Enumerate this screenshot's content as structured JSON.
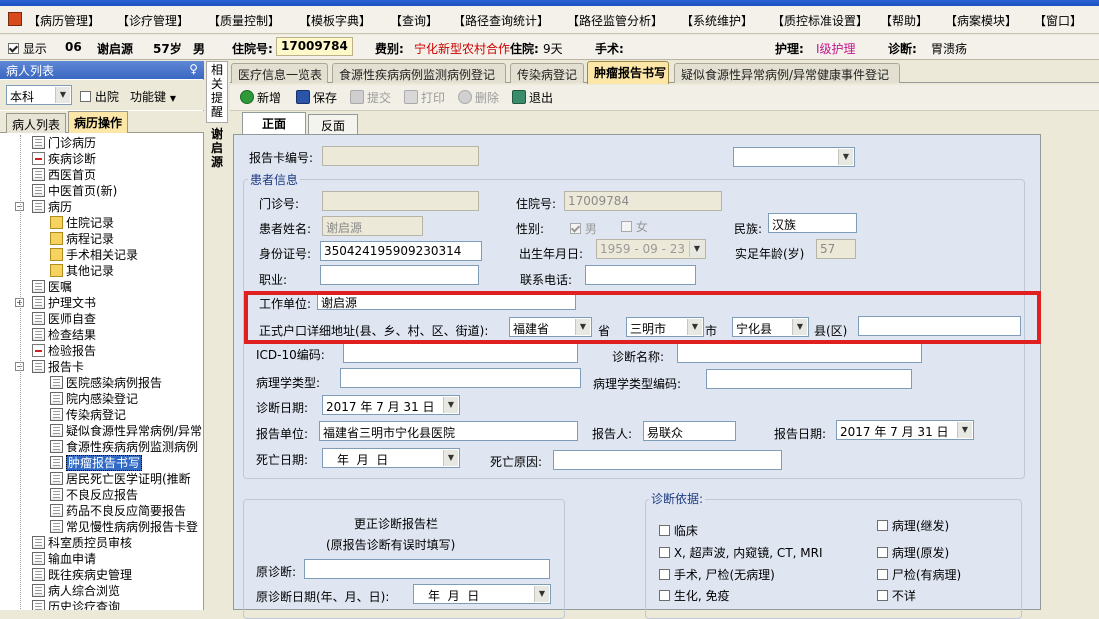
{
  "menu": [
    "【病历管理】",
    "【诊疗管理】",
    "【质量控制】",
    "【模板字典】",
    "【查询】",
    "【路径查询统计】",
    "【路径监管分析】",
    "【系统维护】",
    "【质控标准设置】",
    "【帮助】",
    "【病案模块】",
    "【窗口】"
  ],
  "patient": {
    "show_label": "显示",
    "bed": "06",
    "name": "谢启源",
    "age": "57岁",
    "gender": "男",
    "inpatient_no_label": "住院号:",
    "inpatient_no": "17009784",
    "fee_label": "费别:",
    "fee_type": "宁化新型农村合作",
    "stay_label": "住院:",
    "stay_days": "9天",
    "surgery_label": "手术:",
    "nursing_label": "护理:",
    "nursing_level": "Ⅰ级护理",
    "diagnosis_label": "诊断:",
    "diagnosis": "胃溃疡"
  },
  "left_panel": {
    "title": "病人列表",
    "pin": "♀",
    "dept": "本科",
    "discharged_label": "出院",
    "func_key": "功能键",
    "tabs": [
      "病人列表",
      "病历操作"
    ],
    "tree": [
      {
        "label": "门诊病历",
        "level": 1,
        "icon": "doc"
      },
      {
        "label": "疾病诊断",
        "level": 1,
        "icon": "red"
      },
      {
        "label": "西医首页",
        "level": 1,
        "icon": "doc"
      },
      {
        "label": "中医首页(新)",
        "level": 1,
        "icon": "doc"
      },
      {
        "label": "病历",
        "level": 1,
        "icon": "doc",
        "expand": "−"
      },
      {
        "label": "住院记录",
        "level": 2,
        "icon": "folder"
      },
      {
        "label": "病程记录",
        "level": 2,
        "icon": "folder"
      },
      {
        "label": "手术相关记录",
        "level": 2,
        "icon": "folder"
      },
      {
        "label": "其他记录",
        "level": 2,
        "icon": "folder"
      },
      {
        "label": "医嘱",
        "level": 1,
        "icon": "doc"
      },
      {
        "label": "护理文书",
        "level": 1,
        "icon": "doc",
        "expand": "+"
      },
      {
        "label": "医师自查",
        "level": 1,
        "icon": "doc"
      },
      {
        "label": "检查结果",
        "level": 1,
        "icon": "doc"
      },
      {
        "label": "检验报告",
        "level": 1,
        "icon": "red"
      },
      {
        "label": "报告卡",
        "level": 1,
        "icon": "doc",
        "expand": "−"
      },
      {
        "label": "医院感染病例报告",
        "level": 2,
        "icon": "doc"
      },
      {
        "label": "院内感染登记",
        "level": 2,
        "icon": "doc"
      },
      {
        "label": "传染病登记",
        "level": 2,
        "icon": "doc"
      },
      {
        "label": "疑似食源性异常病例/异常",
        "level": 2,
        "icon": "doc"
      },
      {
        "label": "食源性疾病病例监测病例",
        "level": 2,
        "icon": "doc"
      },
      {
        "label": "肿瘤报告书写",
        "level": 2,
        "icon": "doc",
        "selected": true
      },
      {
        "label": "居民死亡医学证明(推断",
        "level": 2,
        "icon": "doc"
      },
      {
        "label": "不良反应报告",
        "level": 2,
        "icon": "doc"
      },
      {
        "label": "药品不良反应简要报告",
        "level": 2,
        "icon": "doc"
      },
      {
        "label": "常见慢性病病例报告卡登",
        "level": 2,
        "icon": "doc"
      },
      {
        "label": "科室质控员审核",
        "level": 1,
        "icon": "doc"
      },
      {
        "label": "输血申请",
        "level": 1,
        "icon": "doc"
      },
      {
        "label": "既往疾病史管理",
        "level": 1,
        "icon": "doc"
      },
      {
        "label": "病人综合浏览",
        "level": 1,
        "icon": "doc"
      },
      {
        "label": "历史诊疗查询",
        "level": 1,
        "icon": "doc"
      }
    ]
  },
  "side_strip": {
    "top": "相关提醒",
    "bottom": "谢启源"
  },
  "doc_tabs": [
    "医疗信息一览表",
    "食源性疾病病例监测病例登记",
    "传染病登记",
    "肿瘤报告书写",
    "疑似食源性异常病例/异常健康事件登记"
  ],
  "toolbar": {
    "add": "新增",
    "save": "保存",
    "submit": "提交",
    "print": "打印",
    "delete": "删除",
    "exit": "退出"
  },
  "sub_tabs": [
    "正面",
    "反面"
  ],
  "form": {
    "card_no_label": "报告卡编号:",
    "patient_info_title": "患者信息",
    "outpatient_no_label": "门诊号:",
    "inpatient_no_label": "住院号:",
    "inpatient_no": "17009784",
    "name_label": "患者姓名:",
    "name": "谢启源",
    "gender_label": "性别:",
    "male": "男",
    "female": "女",
    "ethnic_label": "民族:",
    "ethnic": "汉族",
    "id_label": "身份证号:",
    "id_no": "350424195909230314",
    "dob_label": "出生年月日:",
    "dob": "1959 - 09 - 23",
    "age_label": "实足年龄(岁)",
    "age": "57",
    "job_label": "职业:",
    "phone_label": "联系电话:",
    "workplace_label": "工作单位:",
    "workplace": "谢启源",
    "address_label": "正式户口详细地址(县、乡、村、区、街道):",
    "province": "福建省",
    "province_suffix": "省",
    "city": "三明市",
    "city_suffix": "市",
    "county": "宁化县",
    "county_suffix": "县(区)",
    "icd_label": "ICD-10编码:",
    "diag_name_label": "诊断名称:",
    "patho_type_label": "病理学类型:",
    "patho_code_label": "病理学类型编码:",
    "diag_date_label": "诊断日期:",
    "diag_date": "2017 年 7 月 31 日",
    "report_unit_label": "报告单位:",
    "report_unit": "福建省三明市宁化县医院",
    "reporter_label": "报告人:",
    "reporter": "易联众",
    "report_date_label": "报告日期:",
    "report_date": "2017 年 7 月 31 日",
    "death_date_label": "死亡日期:",
    "death_date": "年  月  日",
    "death_cause_label": "死亡原因:",
    "correction_title": "更正诊断报告栏",
    "correction_sub": "(原报告诊断有误时填写)",
    "orig_diag_label": "原诊断:",
    "orig_diag_date_label": "原诊断日期(年、月、日):",
    "orig_diag_date": "年  月  日",
    "basis_title": "诊断依据:",
    "basis": [
      "临床",
      "病理(继发)",
      "X, 超声波, 内窥镜, CT, MRI",
      "病理(原发)",
      "手术, 尸检(无病理)",
      "尸检(有病理)",
      "生化, 免疫",
      "不详"
    ]
  },
  "colors": {
    "accent_tab": "#fde7a8",
    "highlight": "#e02020",
    "form_bg": "#dfe6f2"
  }
}
